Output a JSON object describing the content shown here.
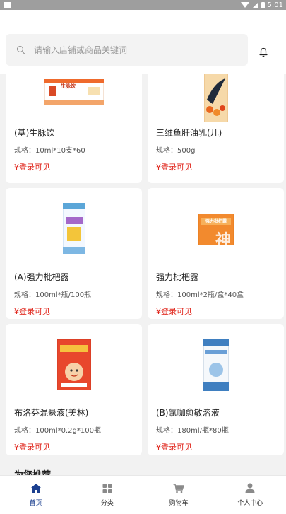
{
  "status_bar": {
    "time": "5:01"
  },
  "search": {
    "placeholder": "请输入店铺或商品关键词"
  },
  "products": [
    {
      "name": "(基)生脉饮",
      "spec": "规格：10ml*10支*60",
      "price": "¥登录可见",
      "box_text": "生脉饮"
    },
    {
      "name": "三维鱼肝油乳(儿)",
      "spec": "规格：500g",
      "price": "¥登录可见"
    },
    {
      "name": "(A)强力枇杷露",
      "spec": "规格：100ml*瓶/100瓶",
      "price": "¥登录可见"
    },
    {
      "name": "强力枇杷露",
      "spec": "规格：100ml*2瓶/盒*40盒",
      "price": "¥登录可见",
      "box_text": "强力枇杷露",
      "brand_char": "神"
    },
    {
      "name": "布洛芬混悬液(美林)",
      "spec": "规格：100ml*0.2g*100瓶",
      "price": "¥登录可见"
    },
    {
      "name": "(B)氯咖愈敏溶液",
      "spec": "规格：180ml/瓶*80瓶",
      "price": "¥登录可见"
    }
  ],
  "recommend_title": "为您推荐",
  "tabs": [
    {
      "label": "首页",
      "icon": "home-icon",
      "active": true
    },
    {
      "label": "分类",
      "icon": "category-icon",
      "active": false
    },
    {
      "label": "购物车",
      "icon": "cart-icon",
      "active": false
    },
    {
      "label": "个人中心",
      "icon": "user-icon",
      "active": false
    }
  ],
  "colors": {
    "accent": "#1b3f8f",
    "price": "#e0251b"
  }
}
